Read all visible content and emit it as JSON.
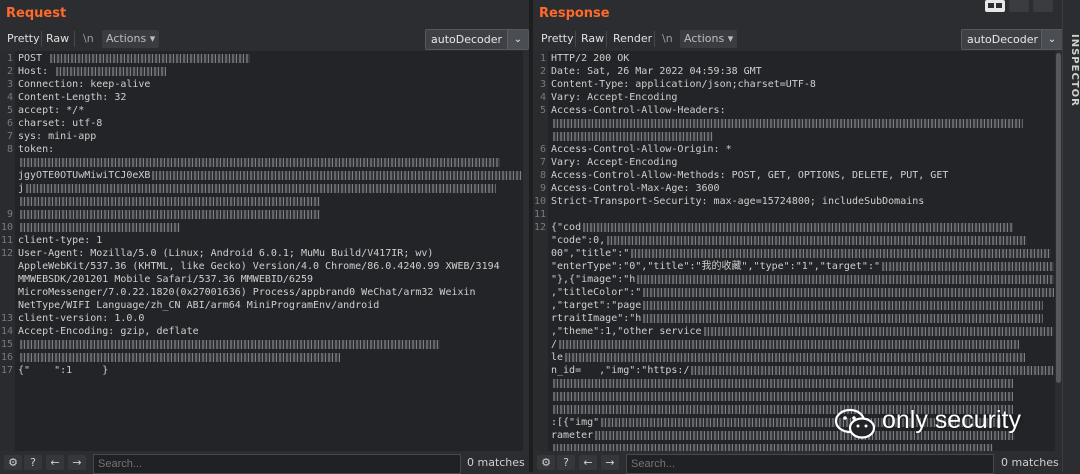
{
  "request": {
    "title": "Request",
    "tabs": [
      "Pretty",
      "Raw",
      "\\n"
    ],
    "actions_label": "Actions",
    "decoder_label": "autoDecoder",
    "lines": [
      {
        "n": "1",
        "t": "POST "
      },
      {
        "n": "2",
        "t": "Host: "
      },
      {
        "n": "3",
        "t": "Connection: keep-alive"
      },
      {
        "n": "4",
        "t": "Content-Length: 32"
      },
      {
        "n": "5",
        "t": "accept: */*"
      },
      {
        "n": "6",
        "t": "charset: utf-8"
      },
      {
        "n": "7",
        "t": "sys: mini-app"
      },
      {
        "n": "8",
        "t": "token:"
      },
      {
        "n": "",
        "t": ""
      },
      {
        "n": "",
        "t": "jgyOTE0OTUwMiwiTCJ0eXB"
      },
      {
        "n": "",
        "t": "j"
      },
      {
        "n": "",
        "t": ""
      },
      {
        "n": "9",
        "t": ""
      },
      {
        "n": "10",
        "t": ""
      },
      {
        "n": "11",
        "t": "client-type: 1"
      },
      {
        "n": "12",
        "t": "User-Agent: Mozilla/5.0 (Linux; Android 6.0.1; MuMu Build/V417IR; wv)"
      },
      {
        "n": "",
        "t": "AppleWebKit/537.36 (KHTML, like Gecko) Version/4.0 Chrome/86.0.4240.99 XWEB/3194"
      },
      {
        "n": "",
        "t": "MMWEBSDK/201201 Mobile Safari/537.36 MMWEBID/6259"
      },
      {
        "n": "",
        "t": "MicroMessenger/7.0.22.1820(0x27001636) Process/appbrand0 WeChat/arm32 Weixin"
      },
      {
        "n": "",
        "t": "NetType/WIFI Language/zh_CN ABI/arm64 MiniProgramEnv/android"
      },
      {
        "n": "13",
        "t": "client-version: 1.0.0"
      },
      {
        "n": "14",
        "t": "Accept-Encoding: gzip, deflate"
      },
      {
        "n": "15",
        "t": ""
      },
      {
        "n": "16",
        "t": ""
      },
      {
        "n": "17",
        "t": "{\"    \":1     }"
      }
    ],
    "search_placeholder": "Search...",
    "matches": "0 matches"
  },
  "response": {
    "title": "Response",
    "tabs": [
      "Pretty",
      "Raw",
      "Render",
      "\\n"
    ],
    "actions_label": "Actions",
    "decoder_label": "autoDecoder",
    "lines": [
      {
        "n": "1",
        "t": "HTTP/2 200 OK"
      },
      {
        "n": "2",
        "t": "Date: Sat, 26 Mar 2022 04:59:38 GMT"
      },
      {
        "n": "3",
        "t": "Content-Type: application/json;charset=UTF-8"
      },
      {
        "n": "4",
        "t": "Vary: Accept-Encoding"
      },
      {
        "n": "5",
        "t": "Access-Control-Allow-Headers:"
      },
      {
        "n": "",
        "t": ""
      },
      {
        "n": "",
        "t": ""
      },
      {
        "n": "6",
        "t": "Access-Control-Allow-Origin: *"
      },
      {
        "n": "7",
        "t": "Vary: Accept-Encoding"
      },
      {
        "n": "8",
        "t": "Access-Control-Allow-Methods: POST, GET, OPTIONS, DELETE, PUT, GET"
      },
      {
        "n": "9",
        "t": "Access-Control-Max-Age: 3600"
      },
      {
        "n": "10",
        "t": "Strict-Transport-Security: max-age=15724800; includeSubDomains"
      },
      {
        "n": "11",
        "t": ""
      },
      {
        "n": "12",
        "t": "{\"cod"
      },
      {
        "n": "",
        "t": "\"code\":0,"
      },
      {
        "n": "",
        "t": "00\",\"title\":\""
      },
      {
        "n": "",
        "t": "\"enterType\":\"0\",\"title\":\"我的收藏\",\"type\":\"1\",\"target\":\""
      },
      {
        "n": "",
        "t": "\"},{\"image\":\"h"
      },
      {
        "n": "",
        "t": ",\"titleColor\":\""
      },
      {
        "n": "",
        "t": ",\"target\":\"page"
      },
      {
        "n": "",
        "t": "rtraitImage\":\"h"
      },
      {
        "n": "",
        "t": ",\"theme\":1,\"other service"
      },
      {
        "n": "",
        "t": "/"
      },
      {
        "n": "",
        "t": "le"
      },
      {
        "n": "",
        "t": "n_id=   ,\"img\":\"https:/"
      },
      {
        "n": "",
        "t": ""
      },
      {
        "n": "",
        "t": ""
      },
      {
        "n": "",
        "t": ""
      },
      {
        "n": "",
        "t": ":[{\"img\""
      },
      {
        "n": "",
        "t": "rameter"
      },
      {
        "n": "",
        "t": ""
      }
    ],
    "search_placeholder": "Search...",
    "matches": "0 matches"
  },
  "inspector_label": "INSPECTOR",
  "watermark_text": "only security",
  "colors": {
    "accent": "#ff6a2c",
    "bg": "#2b2d30",
    "editor_bg": "#232427"
  }
}
